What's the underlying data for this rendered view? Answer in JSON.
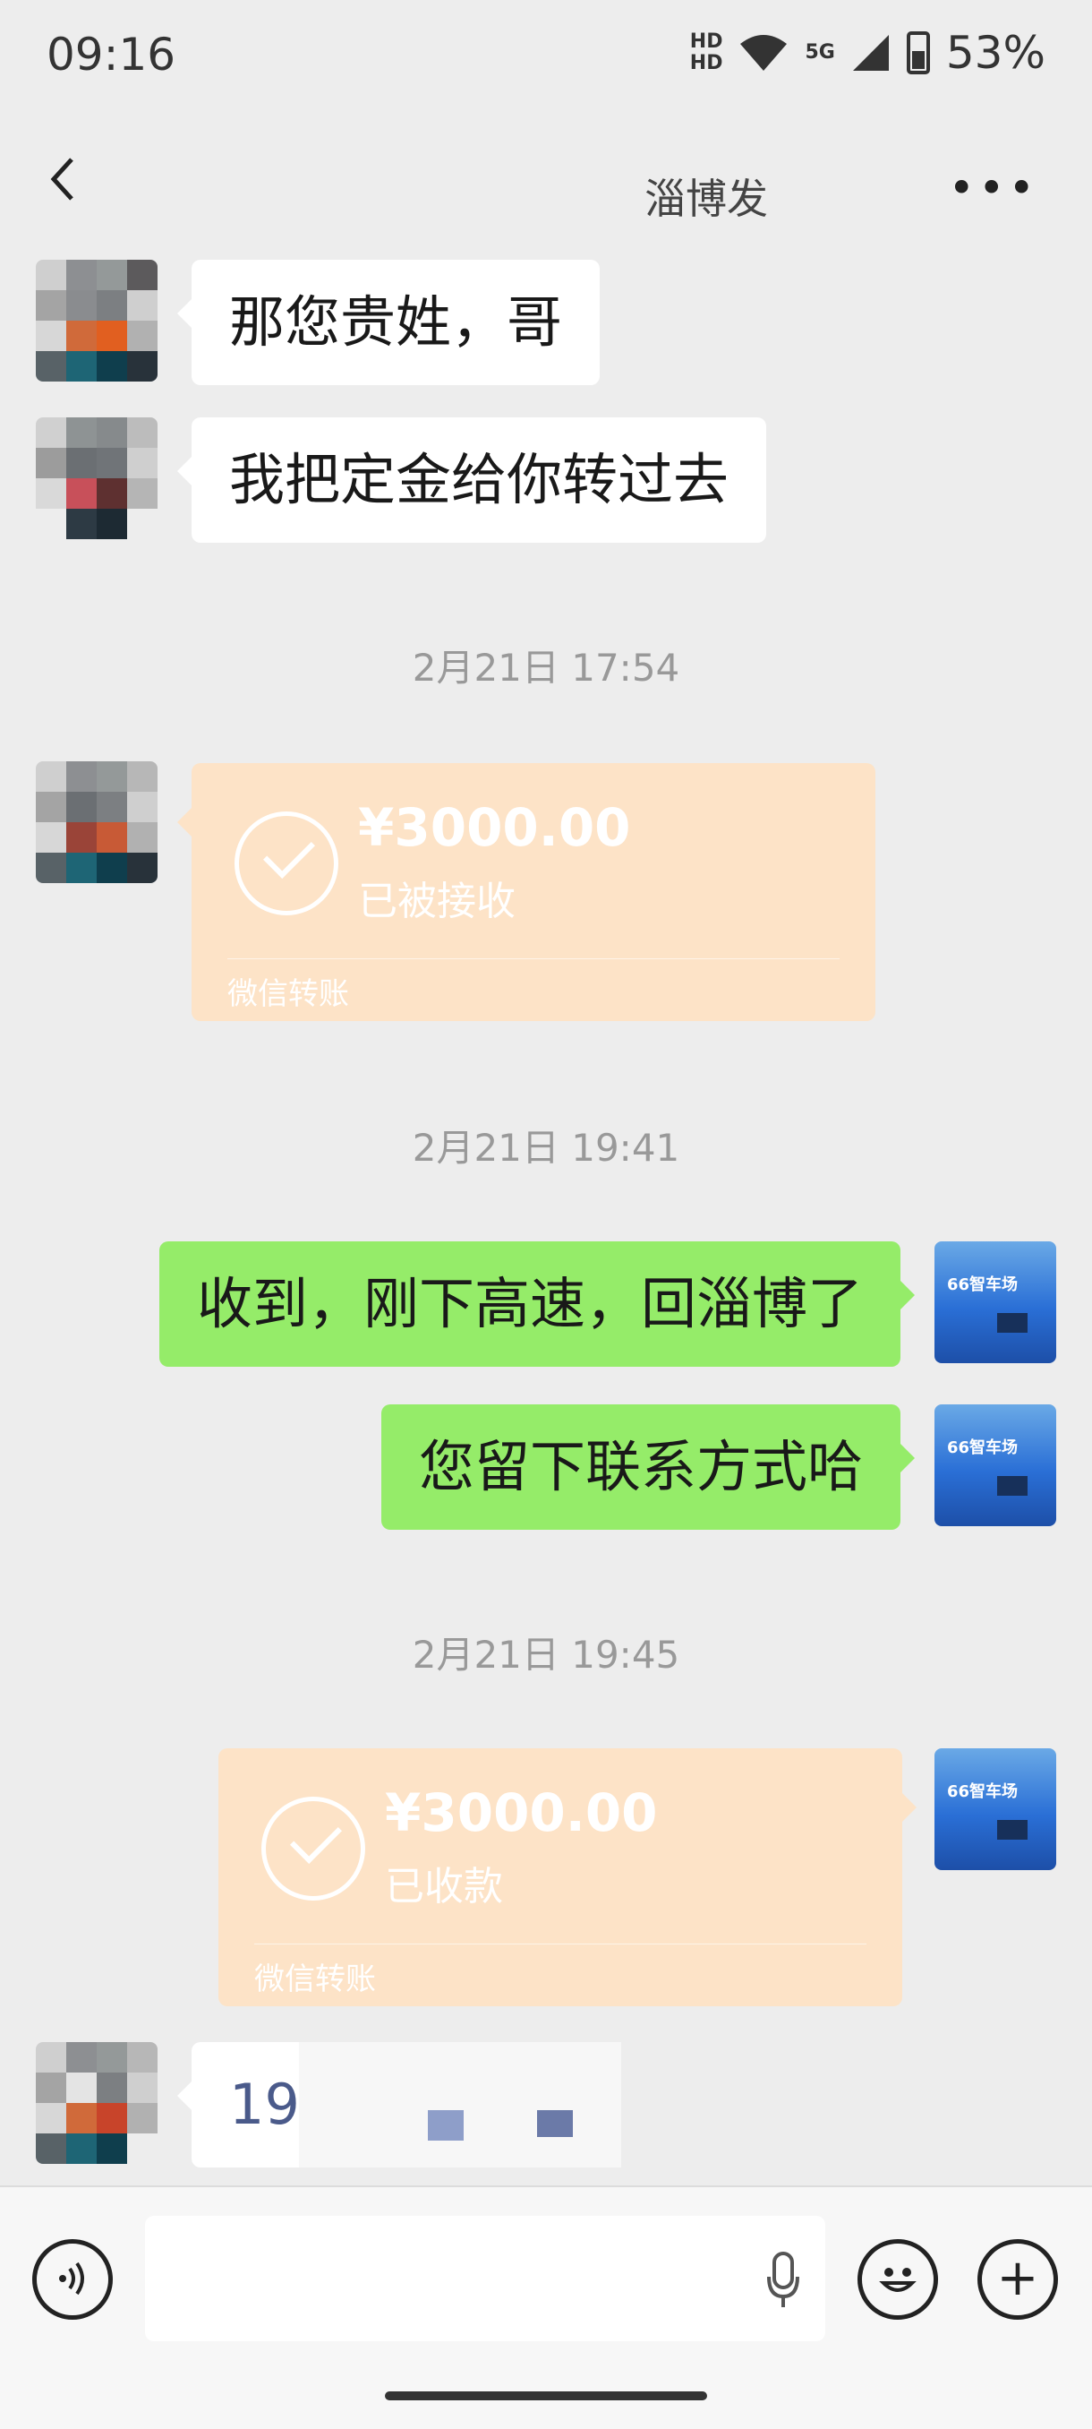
{
  "status_bar": {
    "time": "09:16",
    "network": "5G",
    "battery": "53%"
  },
  "header": {
    "title": "淄博发",
    "back_icon": "chevron-left-icon",
    "more_icon": "more-dots-icon"
  },
  "messages": {
    "m1": "那您贵姓，哥",
    "m2": "我把定金给你转过去",
    "ts1": "2月21日 17:54",
    "transfer1": {
      "amount": "¥3000.00",
      "status": "已被接收",
      "label": "微信转账"
    },
    "ts2": "2月21日 19:41",
    "m3": "收到，刚下高速，回淄博了",
    "m4": "您留下联系方式哈",
    "ts3": "2月21日 19:45",
    "transfer2": {
      "amount": "¥3000.00",
      "status": "已收款",
      "label": "微信转账"
    },
    "m5": "19"
  },
  "self_avatar_text": "66智车场",
  "colors": {
    "self_bubble": "#95ec69",
    "transfer_bubble": "#fde3c7",
    "background": "#ededed"
  },
  "input_bar": {
    "voice_icon": "voice-icon",
    "mic_icon": "mic-icon",
    "emoji_icon": "emoji-icon",
    "plus_icon": "plus-icon"
  }
}
